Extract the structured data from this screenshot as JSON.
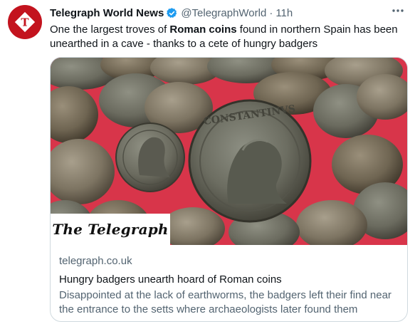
{
  "tweet": {
    "author_name": "Telegraph World News",
    "author_handle": "@TelegraphWorld",
    "separator": "·",
    "timestamp": "11h",
    "text_before": "One the largest troves of ",
    "text_bold": "Roman coins",
    "text_after": " found in northern Spain has been unearthed in a cave - thanks to a cete of hungry badgers"
  },
  "card": {
    "logo_text": "The Telegraph",
    "domain": "telegraph.co.uk",
    "title": "Hungry badgers unearth hoard of Roman coins",
    "description": "Disappointed at the lack of earthworms, the badgers left their find near the entrance to the setts where archaeologists later found them"
  },
  "icons": {
    "avatar": "telegraph-t-logo",
    "verified": "verified-badge-icon",
    "more": "more-options-icon"
  },
  "colors": {
    "brand_red": "#c3131e",
    "verified_blue": "#1d9bf0",
    "secondary_text": "#536471",
    "primary_text": "#0f1419",
    "card_border": "#cfd9de"
  }
}
